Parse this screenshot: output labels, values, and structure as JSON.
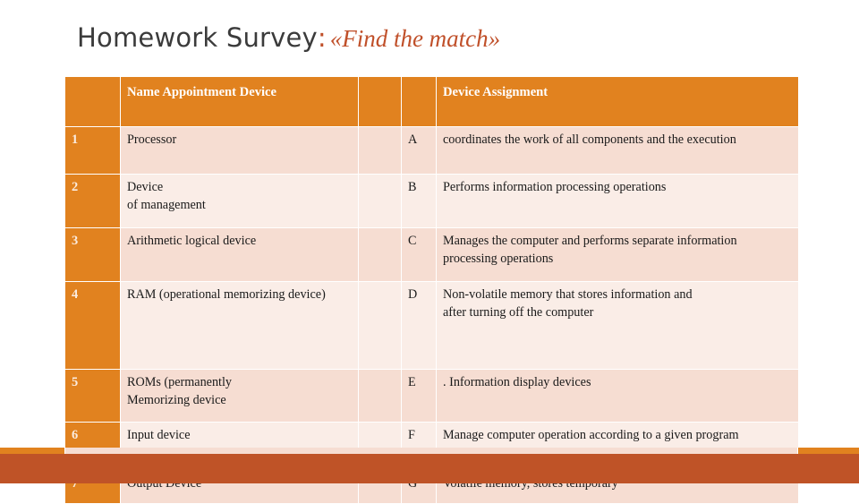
{
  "slide": {
    "title_main": "Homework Survey",
    "title_colon": ":",
    "title_accent": "«Find the match»"
  },
  "theme": {
    "orange": "#E1821F",
    "accent_red": "#C0502A",
    "band_red": "#BF5327",
    "row_dark": "#F6DDD2",
    "row_light": "#FAEDE7",
    "header_text": "#FFFFFF"
  },
  "table": {
    "headers": {
      "num": "",
      "name": "Name Appointment Device",
      "gap": "",
      "letter": "",
      "desc": "Device Assignment"
    },
    "rows": [
      {
        "num": "1",
        "name": "Processor",
        "letter": "A",
        "desc": " coordinates the work of all components and the execution"
      },
      {
        "num": "2",
        "name": "Device\nof management",
        "letter": "B",
        "desc": "Performs information processing operations"
      },
      {
        "num": "3",
        "name": "Arithmetic logical  device",
        "letter": "C",
        "desc": "Manages the computer and performs  separate information processing operations"
      },
      {
        "num": "4",
        "name": "RAM (operational  memorizing device)",
        "letter": "D",
        "desc": "Non-volatile memory that stores information and\nafter turning off the computer"
      },
      {
        "num": "5",
        "name": "ROMs (permanently\nMemorizing  device",
        "letter": "E",
        "desc": ". Information display devices"
      },
      {
        "num": "6",
        "name": "Input device",
        "letter": "F",
        "desc": "Manage computer operation according to a given program"
      },
      {
        "num": "7",
        "name": "Output Device",
        "letter": "G",
        "desc": "Volatile memory, stores temporary"
      }
    ]
  }
}
